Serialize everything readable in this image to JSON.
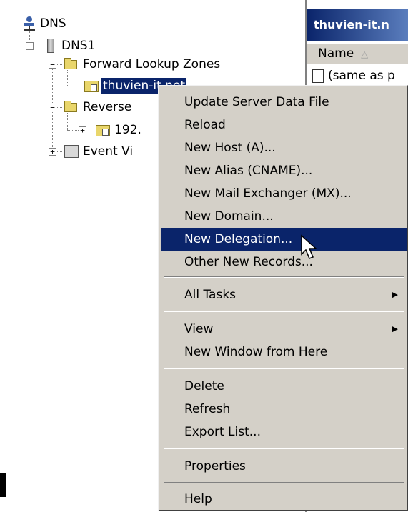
{
  "tree": {
    "root_label": "DNS",
    "server_label": "DNS1",
    "forward_label": "Forward Lookup Zones",
    "zone_label": "thuvien-it.net",
    "reverse_label": "Reverse",
    "reverse_child_label": "192.",
    "event_label": "Event Vi"
  },
  "right_pane": {
    "header": "thuvien-it.n",
    "column_name": "Name",
    "row_first": "(same as p"
  },
  "context_menu": {
    "items": [
      "Update Server Data File",
      "Reload",
      "New Host (A)...",
      "New Alias (CNAME)...",
      "New Mail Exchanger (MX)...",
      "New Domain...",
      "New Delegation...",
      "Other New Records...",
      "All Tasks",
      "View",
      "New Window from Here",
      "Delete",
      "Refresh",
      "Export List...",
      "Properties",
      "Help"
    ],
    "highlighted_index": 6,
    "submenu_arrow": "▶"
  },
  "colors": {
    "highlight": "#0a246a",
    "menu_bg": "#d4d0c8"
  }
}
